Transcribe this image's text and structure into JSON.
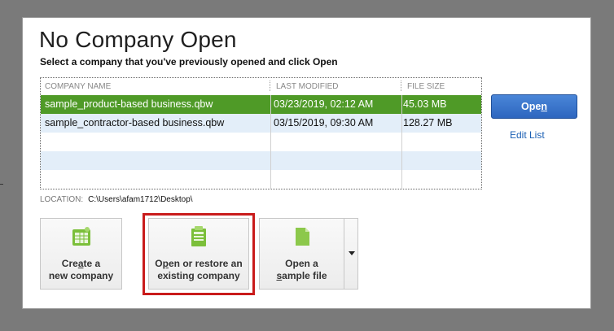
{
  "dialog": {
    "title": "No Company Open",
    "subtitle": "Select a company that you've previously opened and click Open"
  },
  "table": {
    "columns": [
      "COMPANY NAME",
      "LAST MODIFIED",
      "FILE SIZE"
    ],
    "rows": [
      {
        "name": "sample_product-based business.qbw",
        "modified": "03/23/2019, 02:12 AM",
        "size": "45.03 MB",
        "selected": true
      },
      {
        "name": "sample_contractor-based business.qbw",
        "modified": "03/15/2019, 09:30 AM",
        "size": "128.27 MB",
        "selected": false
      }
    ],
    "selected_color": "#4f9a27"
  },
  "actions": {
    "open_label_pre": "Ope",
    "open_label_u": "n",
    "edit_list": "Edit List"
  },
  "location": {
    "label": "LOCATION:",
    "path": "C:\\Users\\afam1712\\Desktop\\"
  },
  "tiles": {
    "create": {
      "line1_pre": "Cre",
      "line1_u": "a",
      "line1_post": "te a",
      "line2": "new company",
      "icon": "spreadsheet-icon"
    },
    "open_restore": {
      "line1_pre": "O",
      "line1_u": "p",
      "line1_post": "en or restore an",
      "line2": "existing company",
      "icon": "document-icon"
    },
    "sample": {
      "line1": "Open a",
      "line2_u": "s",
      "line2_post": "ample file",
      "icon": "file-icon"
    }
  },
  "highlight_color": "#c91b1b"
}
